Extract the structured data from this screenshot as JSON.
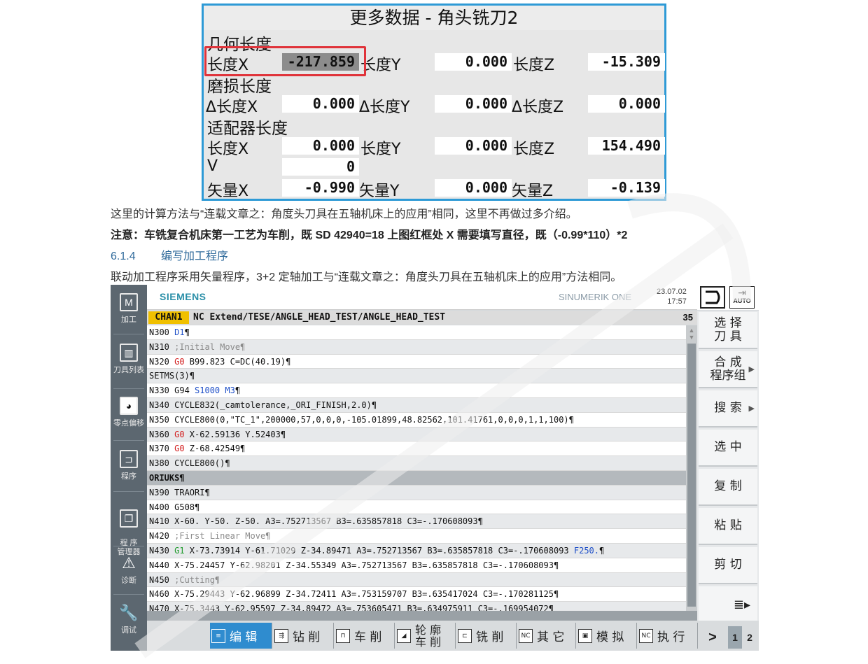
{
  "top_panel": {
    "title": "更多数据 - 角头铣刀2",
    "sections": {
      "geometry": "几何长度",
      "wear": "磨损长度",
      "adapter": "适配器长度"
    },
    "geometry": {
      "lx": "长度X",
      "vx": "-217.859",
      "ly": "长度Y",
      "vy": "0.000",
      "lz": "长度Z",
      "vz": "-15.309"
    },
    "wear": {
      "lx": "Δ长度X",
      "vx": "0.000",
      "ly": "Δ长度Y",
      "vy": "0.000",
      "lz": "Δ长度Z",
      "vz": "0.000"
    },
    "adapter": {
      "lx": "长度X",
      "vx": "0.000",
      "ly": "长度Y",
      "vy": "0.000",
      "lz": "长度Z",
      "vz": "154.490"
    },
    "v": {
      "label": "V",
      "value": "0"
    },
    "vector": {
      "lx": "矢量X",
      "vx": "-0.990",
      "ly": "矢量Y",
      "vy": "0.000",
      "lz": "矢量Z",
      "vz": "-0.139"
    }
  },
  "text": {
    "line1": "这里的计算方法与“连载文章之：角度头刀具在五轴机床上的应用”相同，这里不再做过多介绍。",
    "line2": "注意：车铣复合机床第一工艺为车削，既 SD 42940=18  上图红框处 X 需要填写直径，既（-0.99*110）*2",
    "heading_num": "6.1.4",
    "heading": "编写加工程序",
    "line3": "联动加工程序采用矢量程序，3+2 定轴加工与“连载文章之：角度头刀具在五轴机床上的应用”方法相同。"
  },
  "left_nav": [
    {
      "label": "加工",
      "icon": "machine-icon"
    },
    {
      "label": "刀具列表",
      "icon": "tool-list-icon"
    },
    {
      "label": "零点偏移",
      "icon": "work-offset-icon"
    },
    {
      "label": "程序",
      "icon": "program-icon"
    },
    {
      "label": "程 序\n管理器",
      "icon": "program-manager-icon"
    },
    {
      "label": "诊断",
      "icon": "diagnostics-icon"
    },
    {
      "label": "调试",
      "icon": "commissioning-icon"
    }
  ],
  "header": {
    "brand": "SIEMENS",
    "product": "SINUMERIK ONE",
    "date": "23.07.02",
    "time": "17:57",
    "mode": "AUTO"
  },
  "pathbar": {
    "channel": "CHAN1",
    "path": "NC Extend/TESE/ANGLE_HEAD_TEST/ANGLE_HEAD_TEST",
    "line_number": "35"
  },
  "code_lines": [
    [
      {
        "t": "N300 "
      },
      {
        "t": "D1",
        "c": "blue"
      },
      {
        "t": "¶"
      }
    ],
    [
      {
        "t": "N310 "
      },
      {
        "t": ";Initial Move¶",
        "c": "cmt"
      }
    ],
    [
      {
        "t": "N320 "
      },
      {
        "t": "G0",
        "c": "red"
      },
      {
        "t": " B99.823 C=DC(40.19)¶"
      }
    ],
    [
      {
        "t": "SETMS(3)¶"
      }
    ],
    [
      {
        "t": "N330 G94 "
      },
      {
        "t": "S1000",
        "c": "blue"
      },
      {
        "t": " "
      },
      {
        "t": "M3",
        "c": "blue"
      },
      {
        "t": "¶"
      }
    ],
    [
      {
        "t": "N340 CYCLE832(_camtolerance,_ORI_FINISH,2.0)¶"
      }
    ],
    [
      {
        "t": "N350 CYCLE800(0,\"TC_1\",200000,57,0,0,0,-105.01899,48.82562,101.41761,0,0,0,1,1,100)¶"
      }
    ],
    [
      {
        "t": "N360 "
      },
      {
        "t": "G0",
        "c": "red"
      },
      {
        "t": " X-62.59136 Y.52403¶"
      }
    ],
    [
      {
        "t": "N370 "
      },
      {
        "t": "G0",
        "c": "red"
      },
      {
        "t": " Z-68.42549¶"
      }
    ],
    [
      {
        "t": "N380 CYCLE800()¶"
      }
    ],
    [
      {
        "t": "ORIUKS¶"
      }
    ],
    [
      {
        "t": "N390 TRAORI¶"
      }
    ],
    [
      {
        "t": "N400 G508¶"
      }
    ],
    [
      {
        "t": "N410 X-60. Y-50. Z-50. A3=.752713567 B3=.635857818 C3=-.170608093¶"
      }
    ],
    [
      {
        "t": "N420 "
      },
      {
        "t": ";First Linear Move¶",
        "c": "cmt"
      }
    ],
    [
      {
        "t": "N430 "
      },
      {
        "t": "G1",
        "c": "green"
      },
      {
        "t": " X-73.73914 Y-61.71029 Z-34.89471 A3=.752713567 B3=.635857818 C3=-.170608093 "
      },
      {
        "t": "F250.",
        "c": "blue"
      },
      {
        "t": "¶"
      }
    ],
    [
      {
        "t": "N440 X-75.24457 Y-62.98201 Z-34.55349 A3=.752713567 B3=.635857818 C3=-.170608093¶"
      }
    ],
    [
      {
        "t": "N450 "
      },
      {
        "t": ";Cutting¶",
        "c": "cmt"
      }
    ],
    [
      {
        "t": "N460 X-75.29443 Y-62.96899 Z-34.72411 A3=.753159707 B3=.635417024 C3=-.170281125¶"
      }
    ],
    [
      {
        "t": "N470 X-75.3443 Y-62.95597 Z-34.89472 A3=.753605471 B3=.634975911 C3=-.169954072¶"
      }
    ]
  ],
  "right_softkeys": [
    {
      "label": "选 择\n刀 具",
      "arrow": false
    },
    {
      "label": "合 成\n程序组",
      "arrow": true
    },
    {
      "label": "搜 索",
      "arrow": true
    },
    {
      "label": "选 中",
      "arrow": false
    },
    {
      "label": "复 制",
      "arrow": false
    },
    {
      "label": "粘 贴",
      "arrow": false
    },
    {
      "label": "剪 切",
      "arrow": false
    }
  ],
  "bottom_softkeys": [
    {
      "label": "编 辑",
      "icon": "edit-icon",
      "active": true
    },
    {
      "label": "钻 削",
      "icon": "drill-icon"
    },
    {
      "label": "车 削",
      "icon": "turn-icon"
    },
    {
      "label": "轮 廓\n车 削",
      "icon": "contour-turn-icon"
    },
    {
      "label": "铣 削",
      "icon": "mill-icon"
    },
    {
      "label": "其 它",
      "icon": "nc-other-icon"
    },
    {
      "label": "模 拟",
      "icon": "simulate-icon"
    },
    {
      "label": "执 行",
      "icon": "nc-execute-icon"
    }
  ],
  "pages": [
    "1",
    "2"
  ],
  "more": ">",
  "colors": {
    "accent_blue": "#2f8ccf",
    "channel_yellow": "#f0c000",
    "red_frame": "#e0333a",
    "panel_border": "#2e9ad6"
  }
}
